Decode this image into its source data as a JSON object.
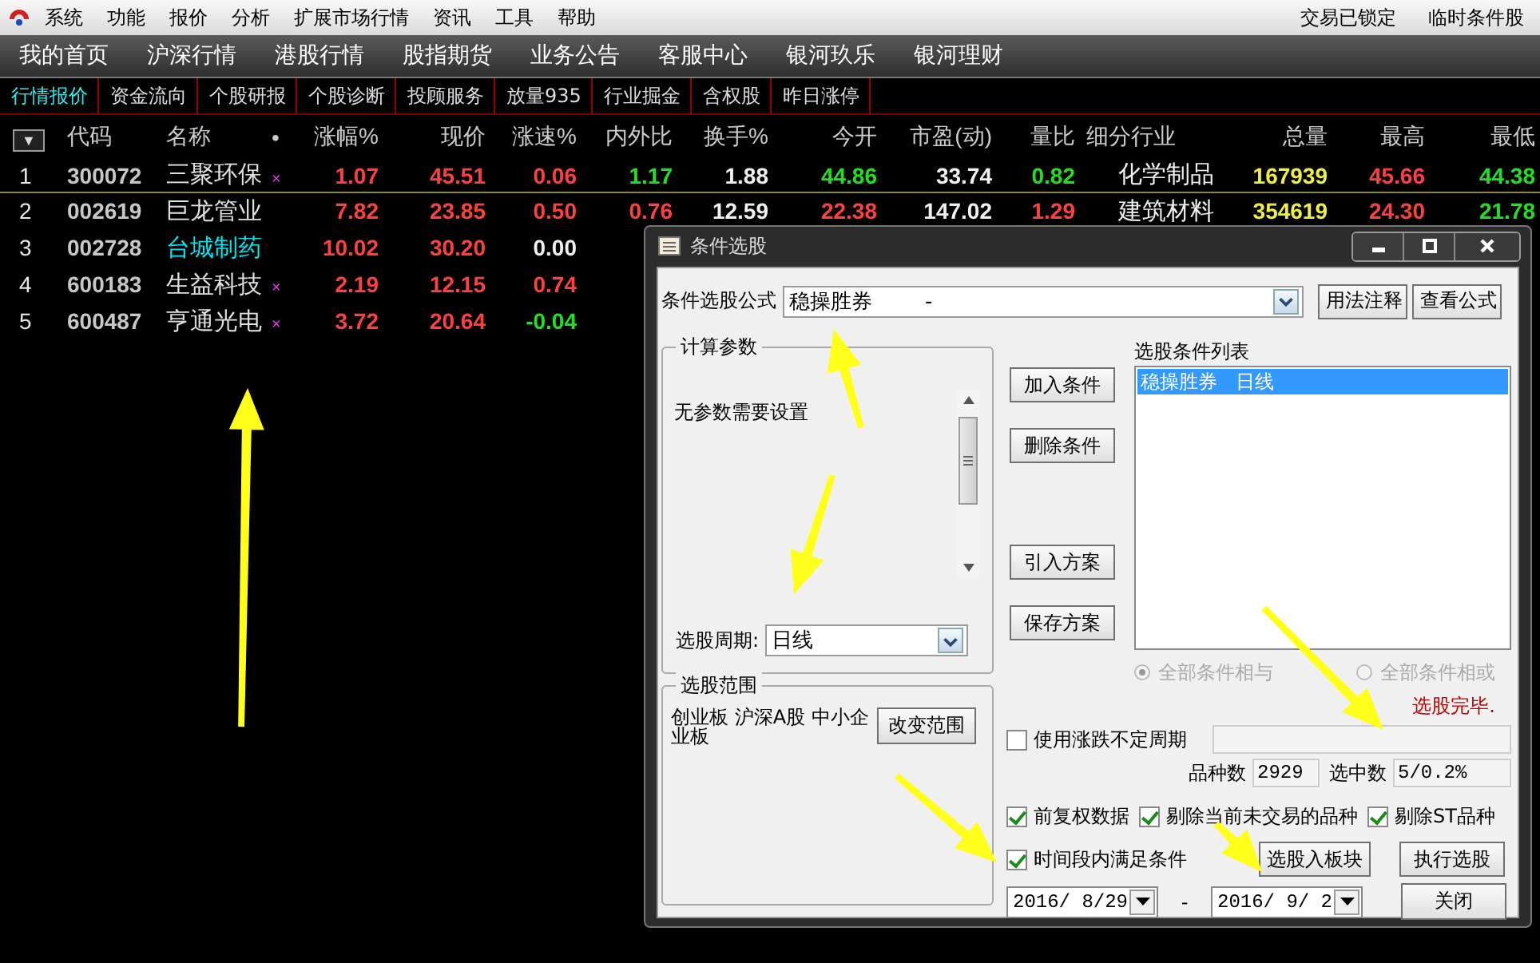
{
  "menu_bar": {
    "items": [
      "系统",
      "功能",
      "报价",
      "分析",
      "扩展市场行情",
      "资讯",
      "工具",
      "帮助"
    ],
    "status": [
      "交易已锁定",
      "临时条件股"
    ]
  },
  "nav_bar": {
    "items": [
      "我的首页",
      "沪深行情",
      "港股行情",
      "股指期货",
      "业务公告",
      "客服中心",
      "银河玖乐",
      "银河理财"
    ]
  },
  "tabs": [
    {
      "label": "行情报价",
      "selected": true
    },
    {
      "label": "资金流向",
      "selected": false
    },
    {
      "label": "个股研报",
      "selected": false
    },
    {
      "label": "个股诊断",
      "selected": false
    },
    {
      "label": "投顾服务",
      "selected": false
    },
    {
      "label": "放量935",
      "selected": false
    },
    {
      "label": "行业掘金",
      "selected": false
    },
    {
      "label": "含权股",
      "selected": false
    },
    {
      "label": "昨日涨停",
      "selected": false
    }
  ],
  "table": {
    "sort_button": "▼",
    "columns": [
      "代码",
      "名称",
      "•",
      "涨幅%",
      "现价",
      "涨速%",
      "内外比",
      "换手%",
      "今开",
      "市盈(动)",
      "量比",
      "细分行业",
      "总量",
      "最高",
      "最低"
    ],
    "rows": [
      {
        "index": "1",
        "selected": true,
        "cells": [
          {
            "text": "300072",
            "kind": "code"
          },
          {
            "text": "三聚环保",
            "color": "#e0e0e0"
          },
          {
            "text": "×",
            "kind": "mark"
          },
          {
            "text": "1.07",
            "kind": "up"
          },
          {
            "text": "45.51",
            "kind": "up"
          },
          {
            "text": "0.06",
            "kind": "up"
          },
          {
            "text": "1.17",
            "kind": "down"
          },
          {
            "text": "1.88",
            "kind": "flat"
          },
          {
            "text": "44.86",
            "kind": "down"
          },
          {
            "text": "33.74",
            "kind": "flat"
          },
          {
            "text": "0.82",
            "kind": "down"
          },
          {
            "text": "化学制品",
            "kind": "label"
          },
          {
            "text": "167939",
            "kind": "volume"
          },
          {
            "text": "45.66",
            "kind": "up"
          },
          {
            "text": "44.38",
            "kind": "down"
          }
        ]
      },
      {
        "index": "2",
        "selected": false,
        "cells": [
          {
            "text": "002619",
            "kind": "code"
          },
          {
            "text": "巨龙管业",
            "color": "#e0e0e0"
          },
          {
            "text": "",
            "kind": "mark"
          },
          {
            "text": "7.82",
            "kind": "up"
          },
          {
            "text": "23.85",
            "kind": "up"
          },
          {
            "text": "0.50",
            "kind": "up"
          },
          {
            "text": "0.76",
            "kind": "up"
          },
          {
            "text": "12.59",
            "kind": "flat"
          },
          {
            "text": "22.38",
            "kind": "up"
          },
          {
            "text": "147.02",
            "kind": "flat"
          },
          {
            "text": "1.29",
            "kind": "up"
          },
          {
            "text": "建筑材料",
            "kind": "label"
          },
          {
            "text": "354619",
            "kind": "volume"
          },
          {
            "text": "24.30",
            "kind": "up"
          },
          {
            "text": "21.78",
            "kind": "down"
          }
        ]
      },
      {
        "index": "3",
        "selected": false,
        "cells": [
          {
            "text": "002728",
            "kind": "code"
          },
          {
            "text": "台城制药",
            "color": "#00e5ee"
          },
          {
            "text": "",
            "kind": "mark"
          },
          {
            "text": "10.02",
            "kind": "up"
          },
          {
            "text": "30.20",
            "kind": "up"
          },
          {
            "text": "0.00",
            "kind": "flat"
          }
        ]
      },
      {
        "index": "4",
        "selected": false,
        "cells": [
          {
            "text": "600183",
            "kind": "code"
          },
          {
            "text": "生益科技",
            "color": "#e0e0e0"
          },
          {
            "text": "×",
            "kind": "mark"
          },
          {
            "text": "2.19",
            "kind": "up"
          },
          {
            "text": "12.15",
            "kind": "up"
          },
          {
            "text": "0.74",
            "kind": "up"
          }
        ]
      },
      {
        "index": "5",
        "selected": false,
        "cells": [
          {
            "text": "600487",
            "kind": "code"
          },
          {
            "text": "亨通光电",
            "color": "#e0e0e0"
          },
          {
            "text": "×",
            "kind": "mark"
          },
          {
            "text": "3.72",
            "kind": "up"
          },
          {
            "text": "20.64",
            "kind": "up"
          },
          {
            "text": "-0.04",
            "kind": "down"
          }
        ]
      }
    ]
  },
  "dialog": {
    "title": "条件选股",
    "formula_label": "条件选股公式",
    "formula_value": "稳操胜券        -",
    "formula_buttons": [
      "用法注释",
      "查看公式"
    ],
    "params": {
      "title": "计算参数",
      "text": "无参数需要设置",
      "period_label": "选股周期:",
      "period_value": "日线"
    },
    "scope": {
      "title": "选股范围",
      "text": "创业板 沪深A股 中小企业板",
      "button": "改变范围"
    },
    "action_buttons": [
      "加入条件",
      "删除条件",
      "引入方案",
      "保存方案"
    ],
    "list": {
      "title": "选股条件列表",
      "items": [
        {
          "label": "稳操胜券   日线",
          "selected": true
        }
      ]
    },
    "logic": [
      {
        "label": "全部条件相与",
        "selected": true,
        "disabled": true
      },
      {
        "label": "全部条件相或",
        "selected": false,
        "disabled": true
      }
    ],
    "status": "选股完毕.",
    "variable_period": {
      "label": "使用涨跌不定周期",
      "checked": false
    },
    "counts": [
      {
        "label": "品种数",
        "value": "2929"
      },
      {
        "label": "选中数",
        "value": "5/0.2%"
      }
    ],
    "options": [
      {
        "label": "前复权数据",
        "checked": true
      },
      {
        "label": "剔除当前未交易的品种",
        "checked": true
      },
      {
        "label": "剔除ST品种",
        "checked": true
      }
    ],
    "period_option": {
      "label": "时间段内满足条件",
      "checked": true
    },
    "date_from": "2016/ 8/29",
    "date_sep": "-",
    "date_to": "2016/ 9/ 2",
    "buttons": [
      "选股入板块",
      "执行选股",
      "关闭"
    ]
  }
}
